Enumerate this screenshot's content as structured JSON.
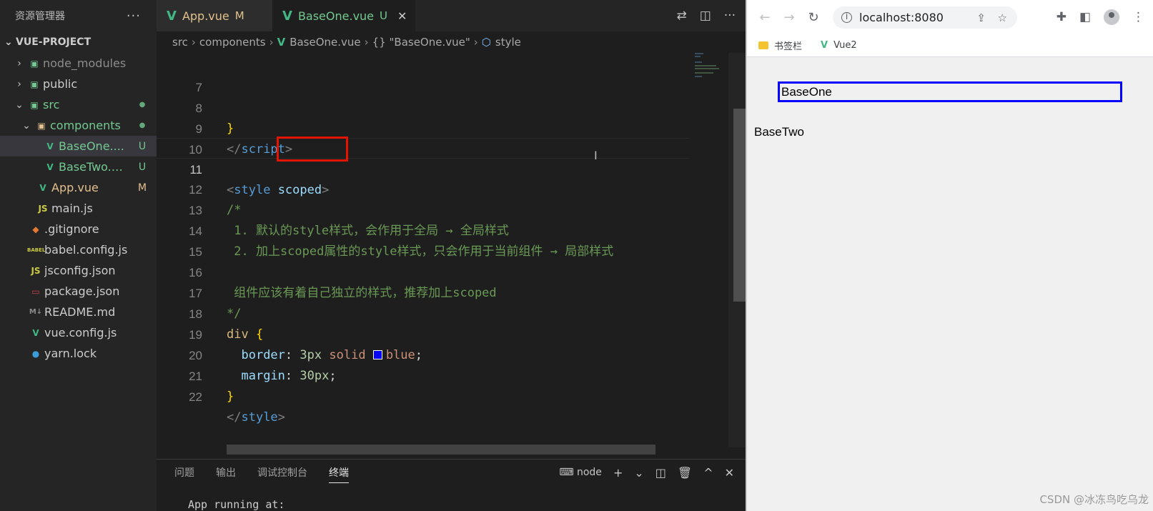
{
  "explorer": {
    "title": "资源管理器",
    "more": "···",
    "project": "VUE-PROJECT",
    "items": [
      {
        "label": "node_modules",
        "chev": "›",
        "icon": "▣",
        "badge": "",
        "dot": false
      },
      {
        "label": "public",
        "chev": "›",
        "icon": "▣",
        "badge": "",
        "dot": false
      },
      {
        "label": "src",
        "chev": "⌄",
        "icon": "▣",
        "badge": "",
        "dot": true
      },
      {
        "label": "components",
        "chev": "⌄",
        "icon": "▣",
        "badge": "",
        "dot": true
      },
      {
        "label": "BaseOne....",
        "chev": "",
        "icon": "V",
        "badge": "U",
        "dot": false
      },
      {
        "label": "BaseTwo.v...",
        "chev": "",
        "icon": "V",
        "badge": "U",
        "dot": false
      },
      {
        "label": "App.vue",
        "chev": "",
        "icon": "V",
        "badge": "M",
        "dot": false
      },
      {
        "label": "main.js",
        "chev": "",
        "icon": "JS",
        "badge": "",
        "dot": false
      },
      {
        "label": ".gitignore",
        "chev": "",
        "icon": "◆",
        "badge": "",
        "dot": false
      },
      {
        "label": "babel.config.js",
        "chev": "",
        "icon": "BABEL",
        "badge": "",
        "dot": false
      },
      {
        "label": "jsconfig.json",
        "chev": "",
        "icon": "JS",
        "badge": "",
        "dot": false
      },
      {
        "label": "package.json",
        "chev": "",
        "icon": "▭",
        "badge": "",
        "dot": false
      },
      {
        "label": "README.md",
        "chev": "",
        "icon": "M↓",
        "badge": "",
        "dot": false
      },
      {
        "label": "vue.config.js",
        "chev": "",
        "icon": "V",
        "badge": "",
        "dot": false
      },
      {
        "label": "yarn.lock",
        "chev": "",
        "icon": "●",
        "badge": "",
        "dot": false
      }
    ]
  },
  "tabs": [
    {
      "label": "App.vue",
      "status": "M"
    },
    {
      "label": "BaseOne.vue",
      "status": "U",
      "close": "✕"
    }
  ],
  "editor_actions": {
    "compare": "⇄",
    "split": "◫",
    "more": "···"
  },
  "breadcrumb": {
    "parts": [
      "src",
      "components",
      "BaseOne.vue",
      "{} \"BaseOne.vue\"",
      "style"
    ],
    "sep": "›"
  },
  "code": {
    "line_numbers": [
      "7",
      "8",
      "9",
      "10",
      "11",
      "12",
      "13",
      "14",
      "15",
      "16",
      "17",
      "18",
      "19",
      "20",
      "21",
      "22"
    ],
    "l8": "}",
    "l9_open": "</",
    "l9_tag": "script",
    "l9_close": ">",
    "l11_open": "<",
    "l11_tag": "style",
    "l11_attr": "scoped",
    "l11_close": ">",
    "l12": "/*",
    "l13": " 1. 默认的style样式，会作用于全局 → 全局样式",
    "l14": " 2. 加上scoped属性的style样式，只会作用于当前组件 → 局部样式",
    "l16": " 组件应该有着自己独立的样式，推荐加上scoped",
    "l17": "*/",
    "l18_sel": "div",
    "l18_brace": "{",
    "l19_prop": "border",
    "l19_colon": ":",
    "l19_num": "3px",
    "l19_val1": "solid",
    "l19_val2": "blue",
    "l19_semi": ";",
    "l20_prop": "margin",
    "l20_colon": ":",
    "l20_num": "30px",
    "l20_semi": ";",
    "l21": "}",
    "l22_open": "</",
    "l22_tag": "style",
    "l22_close": ">",
    "swatch_color": "#0000ff",
    "cursor": "I"
  },
  "panel": {
    "tabs": [
      "问题",
      "输出",
      "调试控制台",
      "终端"
    ],
    "active_tab": "终端",
    "shell": "node",
    "actions": {
      "add": "+",
      "dropdown": "⌄",
      "split": "◫",
      "trash": "🗑",
      "max": "^",
      "close": "✕"
    },
    "terminal_line": "App running at:"
  },
  "browser": {
    "back": "←",
    "forward": "→",
    "reload": "↻",
    "url": "localhost:8080",
    "info": "i",
    "share": "⇪",
    "star": "☆",
    "extensions": "✚",
    "sidepanel": "◧",
    "menu": "⋮",
    "bookmarks": [
      {
        "label": "书签栏",
        "icon": "folder"
      },
      {
        "label": "Vue2",
        "icon": "V"
      }
    ],
    "content": {
      "base_one": "BaseOne",
      "base_two": "BaseTwo",
      "watermark": "CSDN @冰冻鸟吃乌龙"
    }
  },
  "colors": {
    "vue_green": "#41b883",
    "border_blue": "#0000ff",
    "highlight_red": "#e51400"
  }
}
